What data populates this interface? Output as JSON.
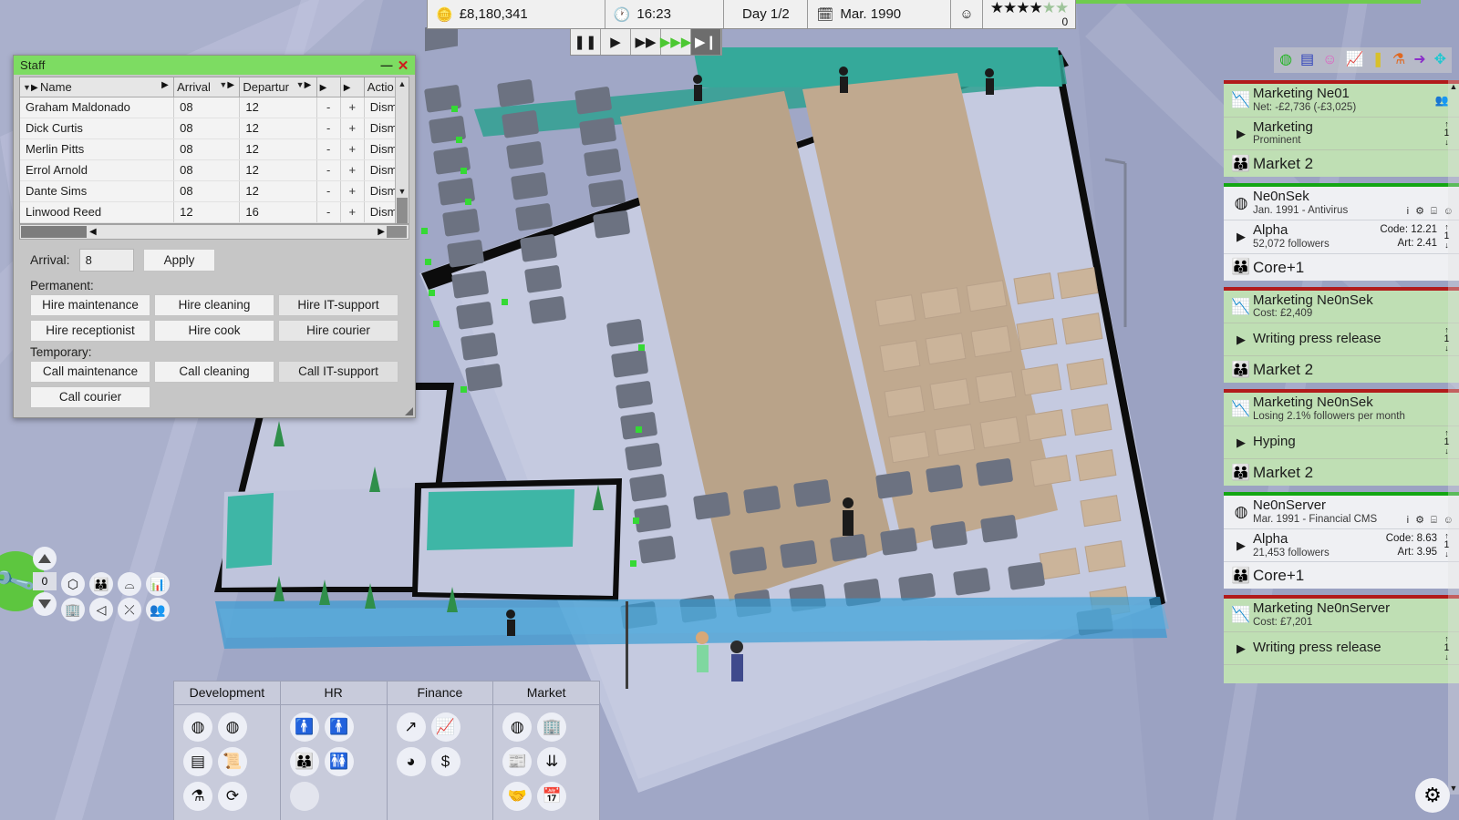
{
  "topbar": {
    "money_icon": "coins-icon",
    "money": "£8,180,341",
    "clock_icon": "clock-icon",
    "time": "16:23",
    "day": "Day 1/2",
    "calendar_icon": "calendar-icon",
    "date": "Mar. 1990",
    "mood_icon": "smiley-icon",
    "stars_filled": 4,
    "stars_total": 6,
    "star_count": "0"
  },
  "speedbar": {
    "buttons": [
      {
        "name": "pause-button",
        "glyph": "❚❚",
        "active": false
      },
      {
        "name": "play-button",
        "glyph": "▶",
        "active": false
      },
      {
        "name": "fast-forward-button",
        "glyph": "▶▶",
        "active": false
      },
      {
        "name": "ultra-fast-button",
        "glyph": "▶▶▶",
        "active": false
      },
      {
        "name": "skip-button",
        "glyph": "▶❙",
        "active": true
      }
    ]
  },
  "top_right_icons": [
    {
      "name": "product-disc-icon",
      "glyph": "◍",
      "color": "#22b522"
    },
    {
      "name": "documents-icon",
      "glyph": "▤",
      "color": "#2b3fbb"
    },
    {
      "name": "happiness-smiley-icon",
      "glyph": "☺",
      "color": "#e060c2"
    },
    {
      "name": "graph-icon",
      "glyph": "📈",
      "color": "#c82020"
    },
    {
      "name": "info-bar-icon",
      "glyph": "❚",
      "color": "#d8c02a"
    },
    {
      "name": "research-flask-icon",
      "glyph": "⚗",
      "color": "#e06820"
    },
    {
      "name": "arrow-right-icon",
      "glyph": "➜",
      "color": "#8b2fc9"
    },
    {
      "name": "target-icon",
      "glyph": "✥",
      "color": "#1fc7d0"
    }
  ],
  "staff_window": {
    "title": "Staff",
    "minimize_label": "—",
    "close_label": "✕",
    "columns": [
      "Name",
      "Arrival",
      "Departur",
      "",
      "",
      "Actio"
    ],
    "rows": [
      {
        "name": "Graham Maldonado",
        "arrival": "08",
        "departure": "12",
        "minus": "-",
        "plus": "+",
        "action": "Dism"
      },
      {
        "name": "Dick Curtis",
        "arrival": "08",
        "departure": "12",
        "minus": "-",
        "plus": "+",
        "action": "Dism"
      },
      {
        "name": "Merlin Pitts",
        "arrival": "08",
        "departure": "12",
        "minus": "-",
        "plus": "+",
        "action": "Dism"
      },
      {
        "name": "Errol Arnold",
        "arrival": "08",
        "departure": "12",
        "minus": "-",
        "plus": "+",
        "action": "Dism"
      },
      {
        "name": "Dante Sims",
        "arrival": "08",
        "departure": "12",
        "minus": "-",
        "plus": "+",
        "action": "Dism"
      },
      {
        "name": "Linwood Reed",
        "arrival": "12",
        "departure": "16",
        "minus": "-",
        "plus": "+",
        "action": "Dism"
      }
    ],
    "arrival_label": "Arrival:",
    "arrival_value": "8",
    "apply_label": "Apply",
    "permanent_label": "Permanent:",
    "permanent_buttons": [
      "Hire maintenance",
      "Hire cleaning",
      "Hire IT-support",
      "Hire receptionist",
      "Hire cook",
      "Hire courier"
    ],
    "temporary_label": "Temporary:",
    "temporary_buttons": [
      "Call maintenance",
      "Call cleaning",
      "Call IT-support",
      "Call courier"
    ]
  },
  "sidebar": {
    "cards": [
      {
        "kind": "marketing",
        "title": "Marketing Ne01",
        "subtitle": "Net: -£2,736 (-£3,025)",
        "task": "Marketing",
        "task_sub": "Prominent",
        "market": "Market 2",
        "spin": "1",
        "has_corner_icon": true
      },
      {
        "kind": "product",
        "title": "Ne0nSek",
        "subtitle": "Jan. 1991 - Antivirus",
        "task": "Alpha",
        "task_sub": "52,072 followers",
        "stat1": "Code: 12.21",
        "stat2": "Art: 2.41",
        "market": "Core+1",
        "spin": "1",
        "mini_icons": "i ⚙ ⌸ ☺"
      },
      {
        "kind": "marketing",
        "title": "Marketing Ne0nSek",
        "subtitle": "Cost: £2,409",
        "task": "Writing press release",
        "task_sub": "",
        "market": "Market 2",
        "spin": "1"
      },
      {
        "kind": "marketing",
        "title": "Marketing Ne0nSek",
        "subtitle": "Losing 2.1% followers per month",
        "task": "Hyping",
        "task_sub": "",
        "market": "Market 2",
        "spin": "1"
      },
      {
        "kind": "product",
        "title": "Ne0nServer",
        "subtitle": "Mar. 1991 - Financial CMS",
        "task": "Alpha",
        "task_sub": "21,453 followers",
        "stat1": "Code: 8.63",
        "stat2": "Art: 3.95",
        "market": "Core+1",
        "spin": "1",
        "mini_icons": "i ⚙ ⌸ ☺"
      },
      {
        "kind": "marketing",
        "title": "Marketing Ne0nServer",
        "subtitle": "Cost: £7,201",
        "task": "Writing press release",
        "task_sub": "",
        "market": "",
        "spin": "1"
      }
    ],
    "scroll_up": "▲",
    "scroll_down": "▼"
  },
  "floor_controls": {
    "wrench_icon": "wrench-icon",
    "floor_value": "0",
    "up_label": "▲",
    "down_label": "▼",
    "icons": [
      {
        "name": "room-cube-icon",
        "glyph": "⬡"
      },
      {
        "name": "staff-group-icon",
        "glyph": "👪"
      },
      {
        "name": "hide-roof-icon",
        "glyph": "⌓"
      },
      {
        "name": "statistics-icon",
        "glyph": "📊"
      },
      {
        "name": "building-icon",
        "glyph": "🏢"
      },
      {
        "name": "sound-icon",
        "glyph": "◁"
      },
      {
        "name": "paths-icon",
        "glyph": "⤫"
      },
      {
        "name": "visitors-icon",
        "glyph": "👥"
      }
    ]
  },
  "bottombar": {
    "tab_icon": "staff-count-icon",
    "tab_count": "0",
    "categories": [
      {
        "label": "Development",
        "icons": [
          {
            "name": "new-product-icon",
            "glyph": "◍"
          },
          {
            "name": "product-icon",
            "glyph": "◍"
          },
          {
            "name": "server-icon",
            "glyph": "▤"
          },
          {
            "name": "contract-icon",
            "glyph": "📜"
          },
          {
            "name": "research-icon",
            "glyph": "⚗"
          },
          {
            "name": "refresh-icon",
            "glyph": "⟳"
          }
        ]
      },
      {
        "label": "HR",
        "icons": [
          {
            "name": "hire-employee-icon",
            "glyph": "🚹"
          },
          {
            "name": "add-employee-icon",
            "glyph": "🚹"
          },
          {
            "name": "team-icon",
            "glyph": "👪"
          },
          {
            "name": "staff-list-icon",
            "glyph": "🚻"
          }
        ]
      },
      {
        "label": "Finance",
        "icons": [
          {
            "name": "growth-arrow-icon",
            "glyph": "↗"
          },
          {
            "name": "finance-graph-icon",
            "glyph": "📈"
          },
          {
            "name": "pie-chart-icon",
            "glyph": "◕"
          },
          {
            "name": "currency-icon",
            "glyph": "$"
          }
        ]
      },
      {
        "label": "Market",
        "icons": [
          {
            "name": "market-discs-icon",
            "glyph": "◍"
          },
          {
            "name": "competitor-building-icon",
            "glyph": "🏢"
          },
          {
            "name": "news-icon",
            "glyph": "📰"
          },
          {
            "name": "distribute-icon",
            "glyph": "⇊"
          },
          {
            "name": "deal-icon",
            "glyph": "🤝"
          },
          {
            "name": "calendar-market-icon",
            "glyph": "📅"
          }
        ]
      }
    ]
  },
  "settings": {
    "gear_icon": "gear-icon",
    "gear_glyph": "⚙"
  }
}
